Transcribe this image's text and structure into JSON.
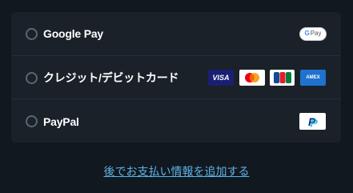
{
  "payment_options": [
    {
      "label": "Google Pay",
      "icon": "google-pay-logo"
    },
    {
      "label": "クレジット/デビットカード",
      "icons": [
        "visa-logo",
        "mastercard-logo",
        "jcb-logo",
        "amex-logo"
      ]
    },
    {
      "label": "PayPal",
      "icon": "paypal-logo"
    }
  ],
  "badges": {
    "gpay_g": "G",
    "gpay_text": "Pay",
    "visa": "VISA",
    "amex": "AMEX",
    "paypal": "P"
  },
  "footer_link": "後でお支払い情報を追加する",
  "colors": {
    "background": "#111820",
    "panel": "#1a2129",
    "link": "#5eb2e6",
    "visa": "#1a1f71",
    "amex": "#1f72cd",
    "mastercard_red": "#eb001b",
    "mastercard_orange": "#f79e1b",
    "paypal_blue": "#003087"
  }
}
